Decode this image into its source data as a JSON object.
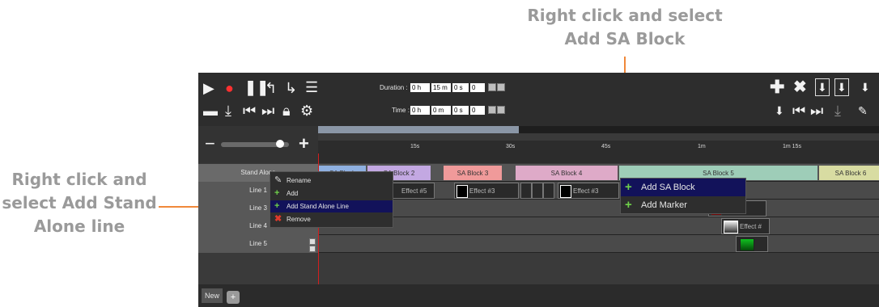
{
  "callouts": {
    "top": "Right click and select\nAdd SA Block",
    "left": "Right click and\nselect Add Stand\nAlone line"
  },
  "toolbar": {
    "duration_label": "Duration :",
    "duration": {
      "h": "0 h",
      "m": "15 m",
      "s": "0 s",
      "f": "0"
    },
    "time_label": "Time :",
    "time": {
      "h": "0 h",
      "m": "0 m",
      "s": "0 s",
      "f": "0"
    }
  },
  "ruler": {
    "ticks": [
      "15s",
      "30s",
      "45s",
      "1m",
      "1m 15s"
    ]
  },
  "rows": {
    "stand_alone": "Stand Alone",
    "lines": [
      "Line 1",
      "Line 3",
      "Line 4",
      "Line 5"
    ]
  },
  "sa_blocks": [
    "SA Block",
    "SA Block 2",
    "SA Block 3",
    "SA Block 4",
    "SA Block 5",
    "SA Block 6"
  ],
  "effects": [
    "Effect #5",
    "Effect #3",
    "Effect #3",
    "#8",
    "Effect #"
  ],
  "context_menu_left": {
    "items": [
      "Rename",
      "Add",
      "Add Stand Alone Line",
      "Remove"
    ]
  },
  "context_menu_right": {
    "items": [
      "Add SA Block",
      "Add Marker"
    ]
  },
  "tabs": {
    "new": "New"
  },
  "colors": {
    "callout_text": "#9a9a9a",
    "callout_line": "#f0883a",
    "record": "#ff3030",
    "menu_selected": "#12125a",
    "add_green": "#6fd14a",
    "remove_red": "#e03a2c"
  },
  "icons": [
    "play-icon",
    "record-icon",
    "pause-icon",
    "step-back-icon",
    "step-forward-icon",
    "list-icon",
    "folder-icon",
    "download-icon",
    "skip-start-icon",
    "skip-end-icon",
    "lock-icon",
    "gear-icon",
    "plus-icon",
    "close-icon",
    "marker-icon",
    "pencil-icon"
  ]
}
